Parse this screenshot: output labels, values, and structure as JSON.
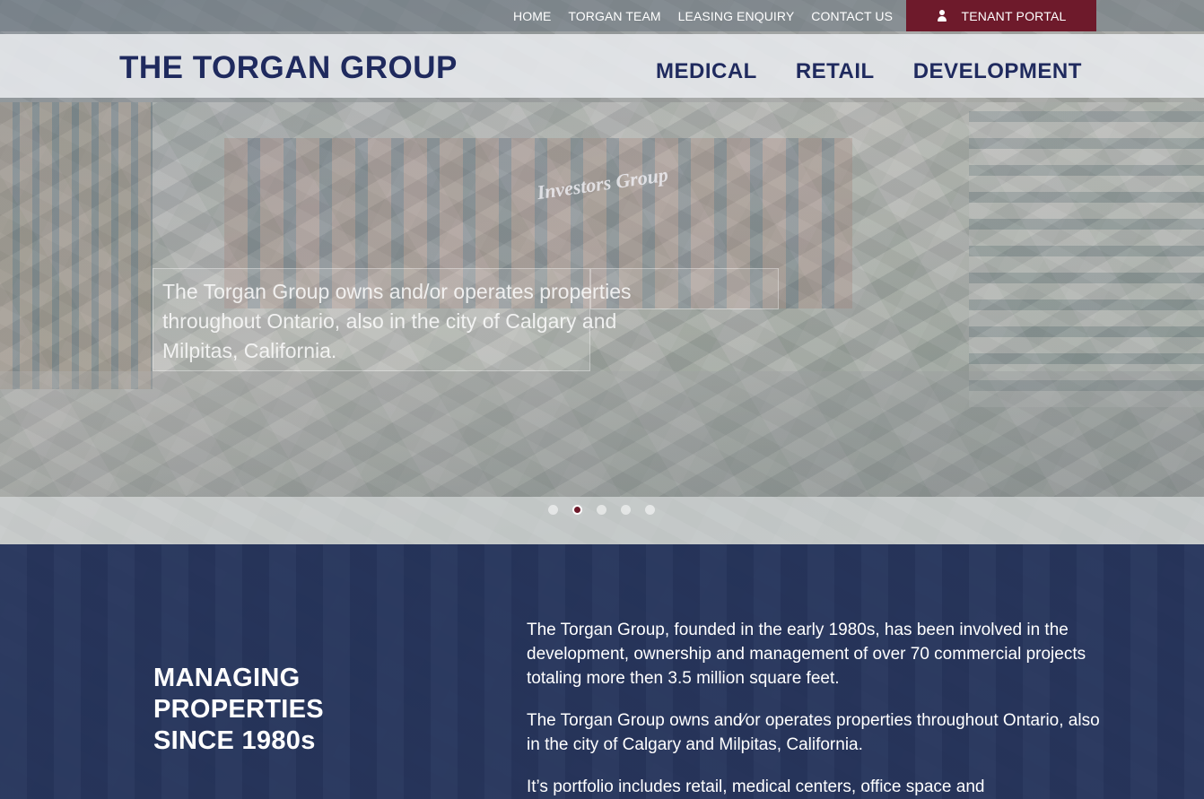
{
  "topbar": {
    "links": [
      "HOME",
      "TORGAN TEAM",
      "LEASING ENQUIRY",
      "CONTACT US"
    ],
    "tenant_portal": "TENANT PORTAL",
    "tenant_icon": "user-icon"
  },
  "header": {
    "logo": "THE TORGAN GROUP",
    "nav": [
      "MEDICAL",
      "RETAIL",
      "DEVELOPMENT"
    ]
  },
  "hero": {
    "caption": "The Torgan Group owns and/or operates properties throughout Ontario, also in the city of Calgary and Milpitas, California.",
    "sign_text": "Investors Group",
    "slide_count": 5,
    "active_slide": 2
  },
  "about": {
    "heading_lines": [
      "MANAGING",
      "PROPERTIES",
      "SINCE 1980s"
    ],
    "paragraphs": [
      "The Torgan Group, founded in the early 1980s, has been involved in the development, ownership and management of over 70 commercial projects totaling more then 3.5 million square feet.",
      "The Torgan Group owns and⁄or operates properties throughout Ontario, also in the city of Calgary and Milpitas, California.",
      "It’s portfolio includes retail, medical centers, office space and"
    ]
  },
  "colors": {
    "brand_navy": "#1f2a5e",
    "tenant_button": "#6e1a2b",
    "about_bg": "#202f58"
  }
}
